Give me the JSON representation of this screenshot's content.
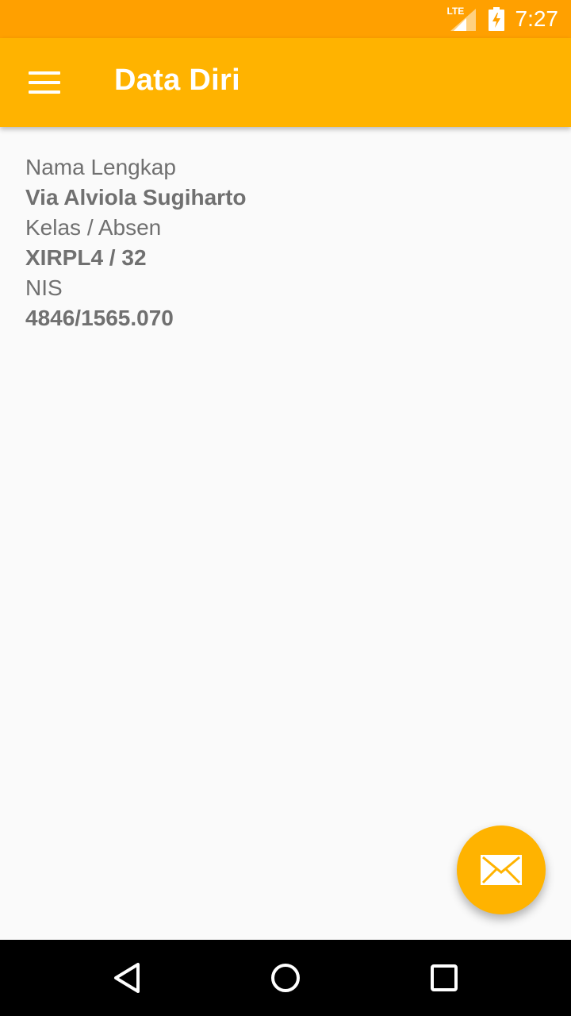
{
  "status_bar": {
    "network_label": "LTE",
    "time": "7:27",
    "icons": [
      "lte-signal-icon",
      "battery-charging-icon"
    ]
  },
  "app_bar": {
    "title": "Data Diri",
    "menu_icon": "hamburger-menu-icon",
    "color": "#FFB300"
  },
  "profile": {
    "fields": [
      {
        "label": "Nama Lengkap",
        "value": "Via Alviola Sugiharto"
      },
      {
        "label": "Kelas / Absen",
        "value": "XIRPL4 / 32"
      },
      {
        "label": "NIS",
        "value": "4846/1565.070"
      }
    ]
  },
  "fab": {
    "icon": "mail-icon",
    "color": "#FFB300"
  },
  "nav_bar": {
    "icons": [
      "back-icon",
      "home-icon",
      "recents-icon"
    ]
  }
}
